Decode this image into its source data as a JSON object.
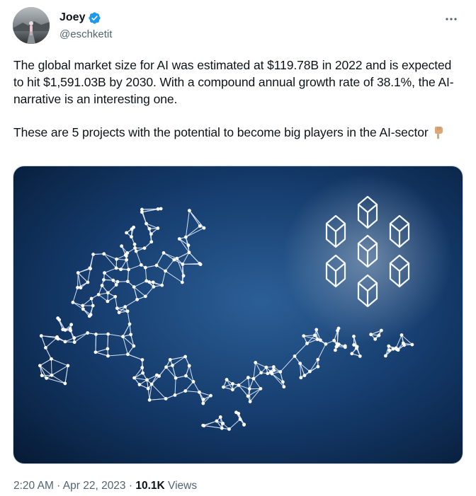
{
  "tweet": {
    "author": {
      "display_name": "Joey",
      "handle": "@eschketit",
      "verified": true,
      "avatar_icon": "avatar-photo-person-on-road"
    },
    "more_icon": "ellipsis-icon",
    "paragraphs": [
      "The global market size for AI was estimated at $119.78B in 2022 and is expected to hit $1,591.03B by 2030. With a compound annual growth rate of 38.1%, the AI-narrative is an interesting one.",
      "These are 5 projects with the potential to become big players in the AI-sector"
    ],
    "emoji": "pointing-down-hand-emoji",
    "media": {
      "kind": "illustration",
      "subject": "wireframe-robot-hand-and-cube-network",
      "background_color": "#0b2547"
    },
    "timestamp": "2:20 AM · Apr 22, 2023",
    "separator": " · ",
    "views_count": "10.1K",
    "views_label": "Views"
  },
  "colors": {
    "primary_text": "#0f1419",
    "secondary_text": "#536471",
    "verified_blue": "#1d9bf0"
  }
}
